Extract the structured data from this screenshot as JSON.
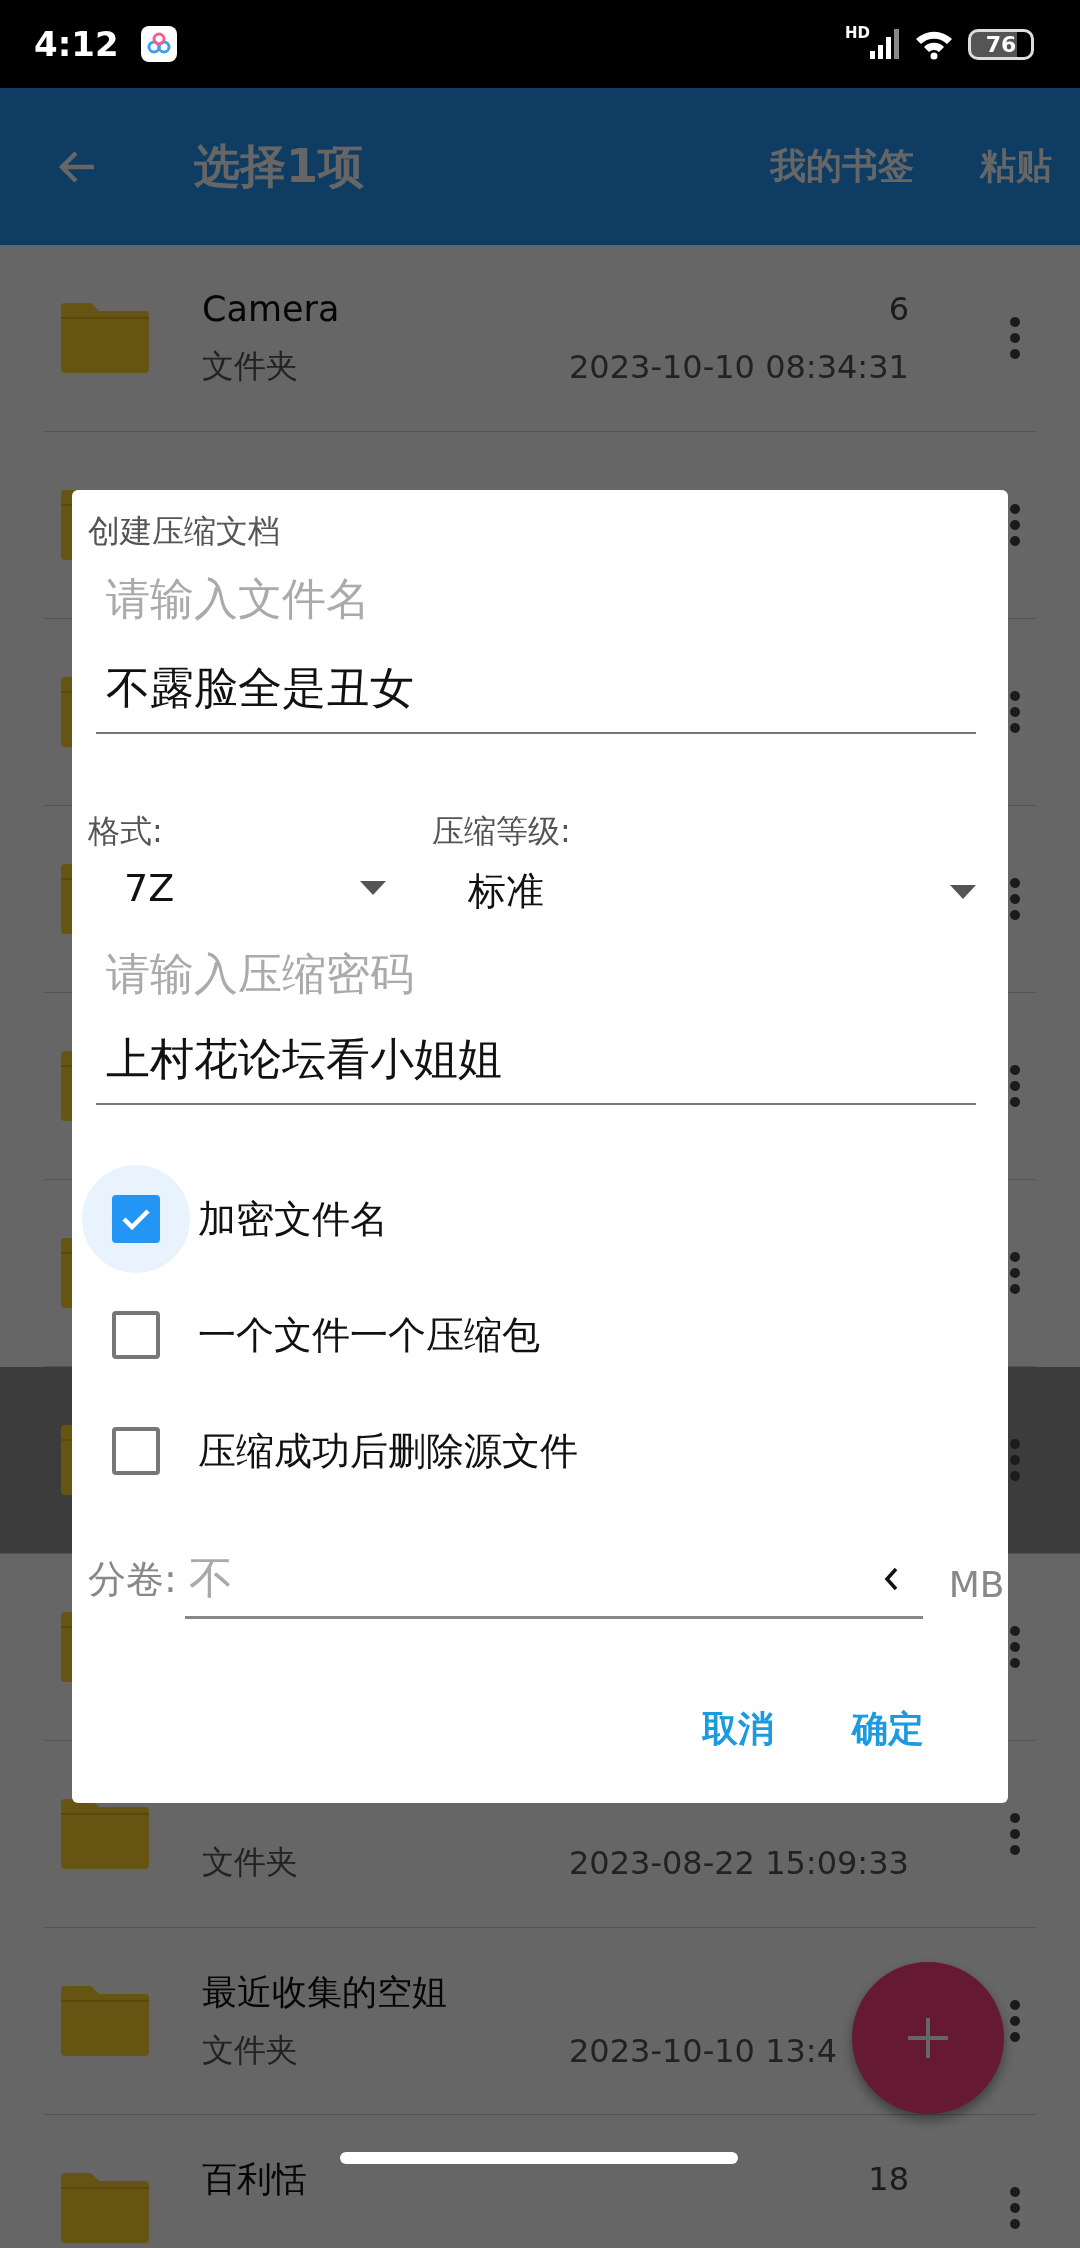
{
  "status_bar": {
    "time": "4:12",
    "network": "HD",
    "battery": "76"
  },
  "app_bar": {
    "title": "选择1项",
    "actions": [
      "我的书签",
      "粘贴"
    ]
  },
  "files": [
    {
      "name": "Camera",
      "count": "6",
      "type": "文件夹",
      "modified": "2023-10-10 08:34:31",
      "selected": false
    },
    {
      "selected": false
    },
    {
      "selected": false
    },
    {
      "selected": false
    },
    {
      "selected": false
    },
    {
      "selected": false
    },
    {
      "selected": true
    },
    {
      "selected": false
    },
    {
      "type": "文件夹",
      "modified": "2023-08-22 15:09:33",
      "selected": false
    },
    {
      "name": "最近收集的空姐",
      "type": "文件夹",
      "modified": "2023-10-10 13:4",
      "selected": false
    },
    {
      "name": "百利恬",
      "count": "18",
      "selected": false
    }
  ],
  "dialog": {
    "title": "创建压缩文档",
    "filename": {
      "placeholder": "请输入文件名",
      "value": "不露脸全是丑女"
    },
    "format": {
      "label": "格式:",
      "value": "7Z"
    },
    "level": {
      "label": "压缩等级:",
      "value": "标准"
    },
    "password": {
      "placeholder": "请输入压缩密码",
      "value": "上村花论坛看小姐姐"
    },
    "options": [
      {
        "label": "加密文件名",
        "checked": true
      },
      {
        "label": "一个文件一个压缩包",
        "checked": false
      },
      {
        "label": "压缩成功后删除源文件",
        "checked": false
      }
    ],
    "split": {
      "label": "分卷:",
      "placeholder": "不",
      "unit": "MB"
    },
    "buttons": [
      "取消",
      "确定"
    ]
  }
}
